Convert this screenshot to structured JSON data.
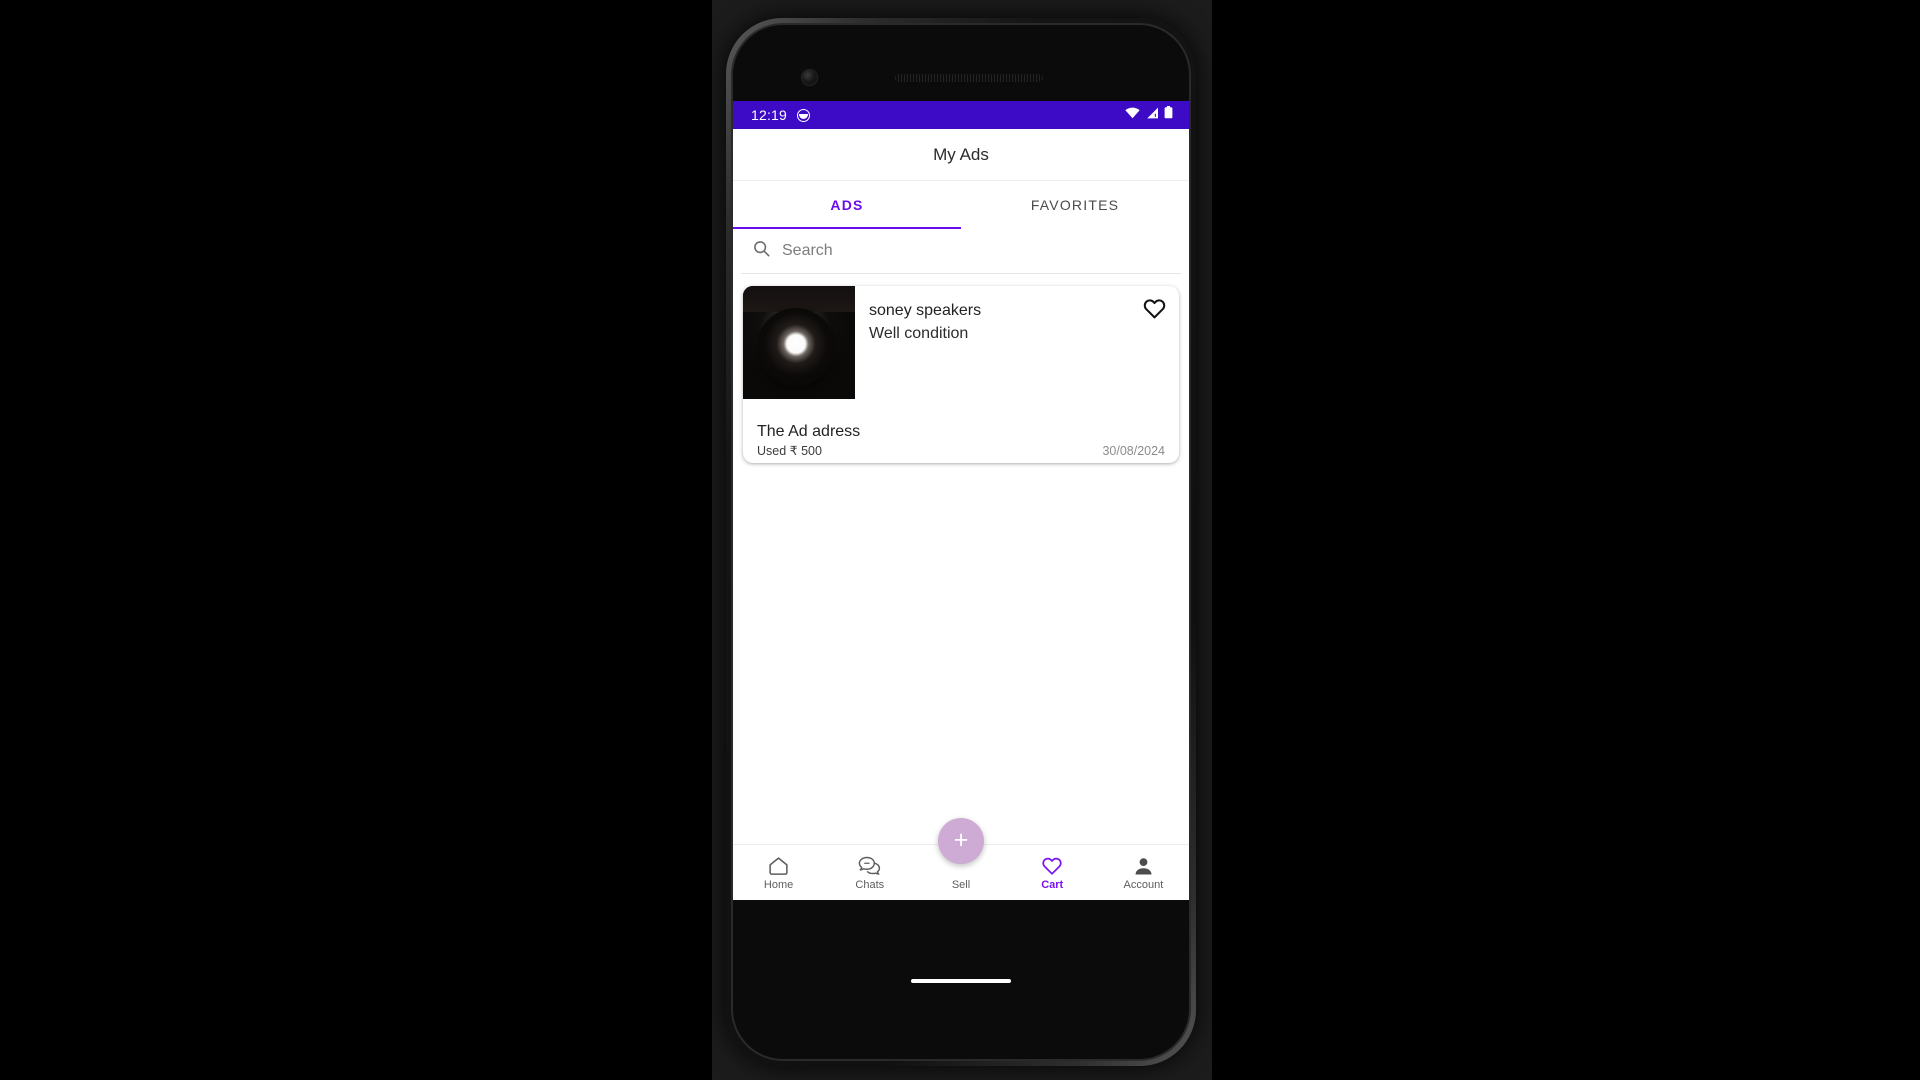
{
  "device": {
    "front_camera_icon": "front-camera-icon",
    "earpiece_icon": "earpiece-speaker-icon",
    "home_indicator": "home-indicator"
  },
  "colors": {
    "status_bar": "#3d0bc6",
    "accent_purple": "#6a0dec",
    "nav_active": "#7b14ef",
    "fab": "#cdabd4",
    "screen_background": "#ffffff"
  },
  "status_bar": {
    "time": "12:19",
    "left_icon": "app-notification-icon",
    "icons": [
      "wifi-icon",
      "cellular-signal-icon",
      "battery-icon"
    ]
  },
  "app_bar": {
    "title": "My Ads"
  },
  "tabs": {
    "items": [
      {
        "label": "ADS",
        "active": true
      },
      {
        "label": "FAVORITES",
        "active": false
      }
    ]
  },
  "search": {
    "icon": "search-icon",
    "value": "",
    "placeholder": "Search"
  },
  "ads": [
    {
      "title": "soney speakers",
      "description": "Well condition",
      "address": "The Ad adress",
      "condition": "Used",
      "currency": "₹",
      "price": "500",
      "price_line": "Used ₹ 500",
      "date": "30/08/2024",
      "favorite_icon": "heart-outline-icon",
      "image_alt": "speaker-thumbnail"
    }
  ],
  "fab": {
    "label": "+",
    "name": "add-ad-fab"
  },
  "bottom_nav": {
    "items": [
      {
        "label": "Home",
        "icon": "home-icon",
        "active": false
      },
      {
        "label": "Chats",
        "icon": "chat-bubbles-icon",
        "active": false
      },
      {
        "label": "Sell",
        "icon": "sell-plus-icon",
        "active": false
      },
      {
        "label": "Cart",
        "icon": "heart-icon",
        "active": true
      },
      {
        "label": "Account",
        "icon": "person-icon",
        "active": false
      }
    ]
  }
}
